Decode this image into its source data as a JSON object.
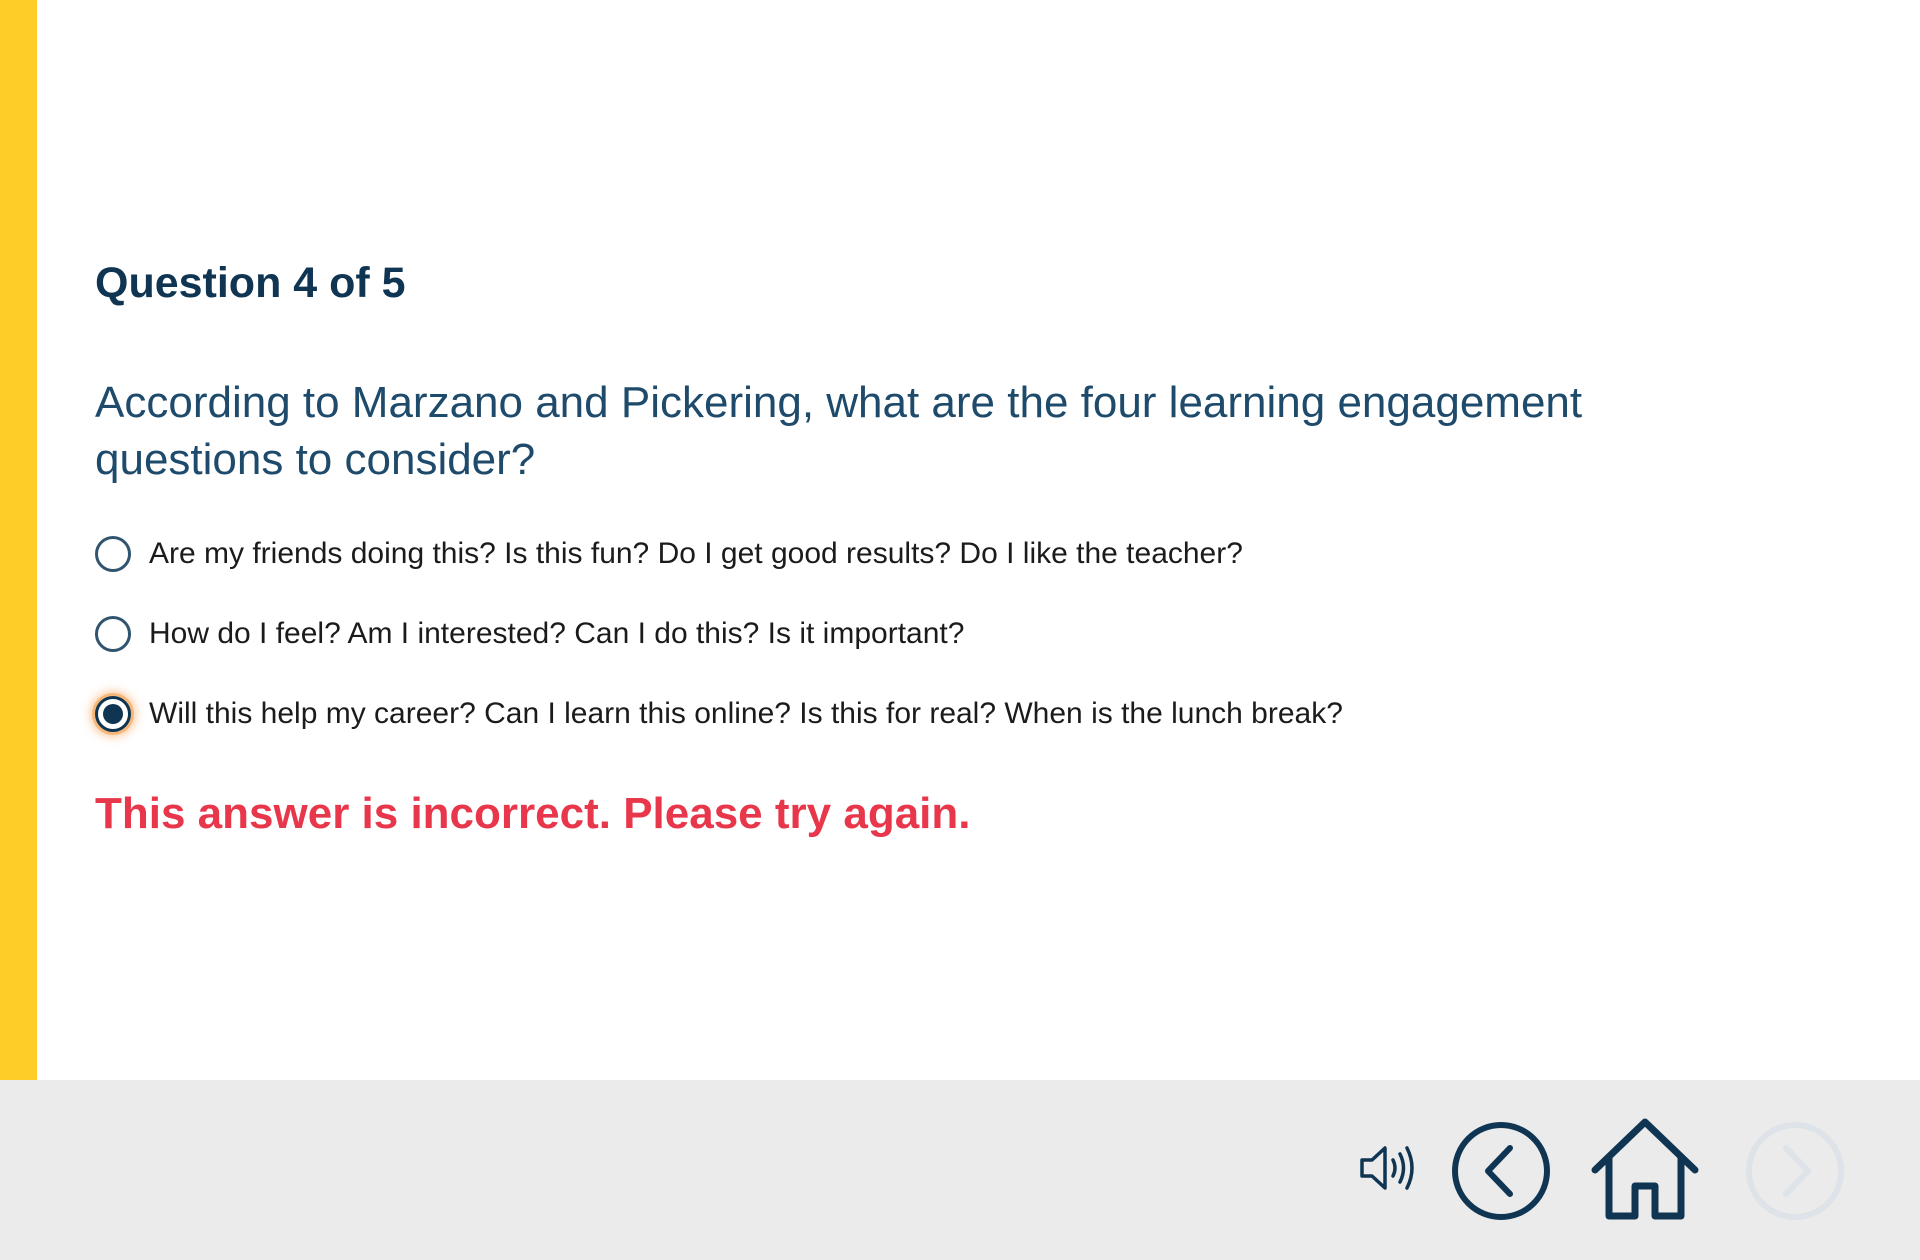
{
  "theme": {
    "accent": "#ffcd27",
    "navy": "#0f3552",
    "question_color": "#1e4a6b",
    "error": "#e8374b",
    "footer_bg": "#ebebeb",
    "disabled": "#dde3e8"
  },
  "quiz": {
    "counter": "Question 4 of 5",
    "question": "According to Marzano and Pickering, what are the four learning engagement questions to consider?",
    "options": [
      {
        "label": "Are my friends doing this? Is this fun? Do I get good results? Do I like the teacher?",
        "selected": false
      },
      {
        "label": "How do I feel? Am I interested? Can I do this? Is it important?",
        "selected": false
      },
      {
        "label": "Will this help my career? Can I learn this online? Is this for real? When is the lunch break?",
        "selected": true
      }
    ],
    "feedback": "This answer is incorrect. Please try again."
  },
  "footer": {
    "controls": [
      {
        "name": "audio",
        "icon": "speaker-icon",
        "enabled": true
      },
      {
        "name": "back",
        "icon": "chevron-left-circle-icon",
        "enabled": true
      },
      {
        "name": "home",
        "icon": "home-icon",
        "enabled": true
      },
      {
        "name": "next",
        "icon": "chevron-right-circle-icon",
        "enabled": false
      }
    ]
  }
}
